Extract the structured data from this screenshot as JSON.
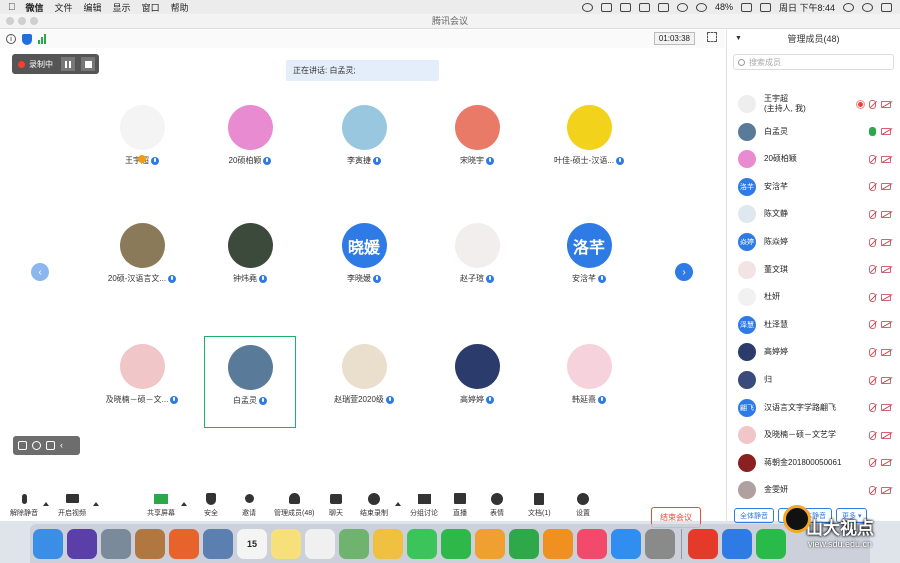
{
  "menubar": {
    "app": "微信",
    "items": [
      "文件",
      "编辑",
      "显示",
      "窗口",
      "帮助"
    ],
    "battery": "48%",
    "clock": "周日 下午8:44"
  },
  "window": {
    "title": "腾讯会议"
  },
  "meeting": {
    "timer": "01:03:38",
    "recording_label": "录制中",
    "speaking": "正在讲话: 白孟灵;"
  },
  "participants": [
    {
      "name": "王宇超",
      "color": "#f4f4f4",
      "initials": ""
    },
    {
      "name": "20硕柏颖",
      "color": "#e98bd0",
      "initials": ""
    },
    {
      "name": "李寅捷",
      "color": "#9ac7e0",
      "initials": ""
    },
    {
      "name": "宋晓宇",
      "color": "#e97a68",
      "initials": ""
    },
    {
      "name": "叶佳-硕士-汉语...",
      "color": "#f2d21b",
      "initials": ""
    },
    {
      "name": "20硕-汉语言文...",
      "color": "#8a7a5a",
      "initials": ""
    },
    {
      "name": "钟炜堯",
      "color": "#3b4a3a",
      "initials": ""
    },
    {
      "name": "李晓媛",
      "color": "#2f7be5",
      "initials": "晓媛"
    },
    {
      "name": "赵子瑄",
      "color": "#f3eeee",
      "initials": ""
    },
    {
      "name": "安浛芊",
      "color": "#2f7be5",
      "initials": "洛芊"
    },
    {
      "name": "及晓楠－硕－文...",
      "color": "#f1c6c9",
      "initials": ""
    },
    {
      "name": "白孟灵",
      "color": "#5a7a9a",
      "initials": ""
    },
    {
      "name": "赵瑞萱2020级",
      "color": "#eadfcc",
      "initials": ""
    },
    {
      "name": "高婷婷",
      "color": "#2b3b6b",
      "initials": ""
    },
    {
      "name": "韩延熹",
      "color": "#f6d2dc",
      "initials": ""
    }
  ],
  "toolbar": {
    "mute": "解除静音",
    "video": "开启视频",
    "share": "共享屏幕",
    "security": "安全",
    "invite": "邀请",
    "members": "管理成员(48)",
    "chat": "聊天",
    "record": "结束录制",
    "breakout": "分组讨论",
    "live": "直播",
    "emoji": "表情",
    "docs": "文档(1)",
    "settings": "设置",
    "end": "结束会议"
  },
  "sidebar": {
    "title": "管理成员(48)",
    "search_placeholder": "搜索成员",
    "members": [
      {
        "name": "王宇超",
        "sub": "(主持人, 我)",
        "color": "#eeeeee",
        "initials": "",
        "mic": "off",
        "rec": true
      },
      {
        "name": "白孟灵",
        "sub": "",
        "color": "#5a7a9a",
        "initials": "",
        "mic": "on",
        "rec": false
      },
      {
        "name": "20硕柏颖",
        "sub": "",
        "color": "#e98bd0",
        "initials": "",
        "mic": "off",
        "rec": false
      },
      {
        "name": "安浛芊",
        "sub": "",
        "color": "#2f7be5",
        "initials": "洛芊",
        "mic": "off",
        "rec": false
      },
      {
        "name": "陈文静",
        "sub": "",
        "color": "#dfe7ef",
        "initials": "",
        "mic": "off",
        "rec": false
      },
      {
        "name": "陈焱婷",
        "sub": "",
        "color": "#2f7be5",
        "initials": "焱婷",
        "mic": "off",
        "rec": false
      },
      {
        "name": "董文琪",
        "sub": "",
        "color": "#f3e3e3",
        "initials": "",
        "mic": "off",
        "rec": false
      },
      {
        "name": "杜妍",
        "sub": "",
        "color": "#f1f1f1",
        "initials": "",
        "mic": "off",
        "rec": false
      },
      {
        "name": "杜泽慧",
        "sub": "",
        "color": "#2f7be5",
        "initials": "泽慧",
        "mic": "off",
        "rec": false
      },
      {
        "name": "高婷婷",
        "sub": "",
        "color": "#2b3b6b",
        "initials": "",
        "mic": "off",
        "rec": false
      },
      {
        "name": "归",
        "sub": "",
        "color": "#3a4a7a",
        "initials": "",
        "mic": "off",
        "rec": false
      },
      {
        "name": "汉语言文字学路翩飞",
        "sub": "",
        "color": "#2f7be5",
        "initials": "翩飞",
        "mic": "off",
        "rec": false
      },
      {
        "name": "及晓楠－硕－文艺学",
        "sub": "",
        "color": "#f1c6c9",
        "initials": "",
        "mic": "off",
        "rec": false
      },
      {
        "name": "蒋朝金201800050061",
        "sub": "",
        "color": "#8a2020",
        "initials": "",
        "mic": "off",
        "rec": false
      },
      {
        "name": "金雯妍",
        "sub": "",
        "color": "#b0a0a0",
        "initials": "",
        "mic": "off",
        "rec": false
      }
    ],
    "mute_all": "全体静音",
    "unmute_all": "解除全体静音",
    "more": "更多"
  },
  "dock": [
    {
      "name": "finder",
      "color": "#3a8ee6"
    },
    {
      "name": "siri",
      "color": "#5b3fa8"
    },
    {
      "name": "launchpad",
      "color": "#7a8a9a"
    },
    {
      "name": "notebook",
      "color": "#b07840"
    },
    {
      "name": "firefox",
      "color": "#e8632b"
    },
    {
      "name": "preview",
      "color": "#5a7fb0"
    },
    {
      "name": "calendar",
      "color": "#f4f4f4"
    },
    {
      "name": "notes",
      "color": "#f7e07a"
    },
    {
      "name": "reminders",
      "color": "#f0f0f0"
    },
    {
      "name": "maps",
      "color": "#6fb36f"
    },
    {
      "name": "photos",
      "color": "#f0c040"
    },
    {
      "name": "messages",
      "color": "#3ac45a"
    },
    {
      "name": "facetime",
      "color": "#2eb84a"
    },
    {
      "name": "pages",
      "color": "#f0a030"
    },
    {
      "name": "numbers",
      "color": "#2fa84a"
    },
    {
      "name": "books",
      "color": "#f09020"
    },
    {
      "name": "music",
      "color": "#f24a6a"
    },
    {
      "name": "appstore",
      "color": "#2f8ef0"
    },
    {
      "name": "system-preferences",
      "color": "#8a8a8a"
    },
    {
      "name": "wps",
      "color": "#e33a2a"
    },
    {
      "name": "tencent-meeting",
      "color": "#2f7be5"
    },
    {
      "name": "wechat",
      "color": "#2aba4a"
    }
  ],
  "calendar_day": "15",
  "watermark": {
    "main": "山大视点",
    "url": "view.sdu.edu.cn"
  }
}
